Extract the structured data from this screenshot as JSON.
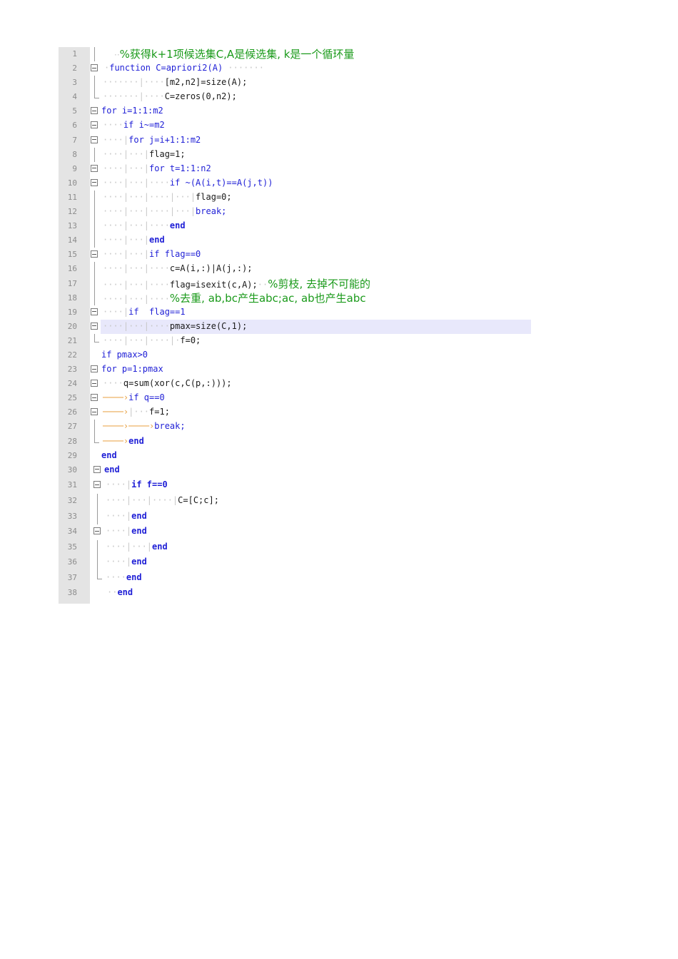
{
  "lines": [
    {
      "n": "1",
      "t": "%获得k+1项候选集C,A是候选集, k是一个循环量"
    },
    {
      "n": "2",
      "t": "function C=apriori2(A)"
    },
    {
      "n": "3",
      "t": "[m2,n2]=size(A);"
    },
    {
      "n": "4",
      "t": "C=zeros(0,n2);"
    },
    {
      "n": "5",
      "t": "for i=1:1:m2"
    },
    {
      "n": "6",
      "t": "if i~=m2"
    },
    {
      "n": "7",
      "t": "for j=i+1:1:m2"
    },
    {
      "n": "8",
      "t": "flag=1;"
    },
    {
      "n": "9",
      "t": "for t=1:1:n2"
    },
    {
      "n": "10",
      "t": "if ~(A(i,t)==A(j,t))"
    },
    {
      "n": "11",
      "t": "flag=0;"
    },
    {
      "n": "12",
      "t": "break;"
    },
    {
      "n": "13",
      "t": "end"
    },
    {
      "n": "14",
      "t": "end"
    },
    {
      "n": "15",
      "t": "if flag==0"
    },
    {
      "n": "16",
      "t": "c=A(i,:)|A(j,:);"
    },
    {
      "n": "17",
      "t": "flag=isexit(c,A);",
      "c": "%剪枝, 去掉不可能的"
    },
    {
      "n": "18",
      "t": "%去重, ab,bc产生abc;ac, ab也产生abc"
    },
    {
      "n": "19",
      "t": "if  flag==1"
    },
    {
      "n": "20",
      "t": "pmax=size(C,1);"
    },
    {
      "n": "21",
      "t": "f=0;"
    },
    {
      "n": "22",
      "t": "if pmax>0"
    },
    {
      "n": "23",
      "t": "for p=1:pmax"
    },
    {
      "n": "24",
      "t": "q=sum(xor(c,C(p,:)));"
    },
    {
      "n": "25",
      "t": "if q==0"
    },
    {
      "n": "26",
      "t": "f=1;"
    },
    {
      "n": "27",
      "t": "break;"
    },
    {
      "n": "28",
      "t": "end"
    },
    {
      "n": "29",
      "t": "end"
    },
    {
      "n": "30",
      "t": "end"
    },
    {
      "n": "31",
      "t": "if f==0"
    },
    {
      "n": "32",
      "t": "C=[C;c];"
    },
    {
      "n": "33",
      "t": "end"
    },
    {
      "n": "34",
      "t": "end"
    },
    {
      "n": "35",
      "t": "end"
    },
    {
      "n": "36",
      "t": "end"
    },
    {
      "n": "37",
      "t": "end"
    },
    {
      "n": "38",
      "t": "end"
    }
  ]
}
